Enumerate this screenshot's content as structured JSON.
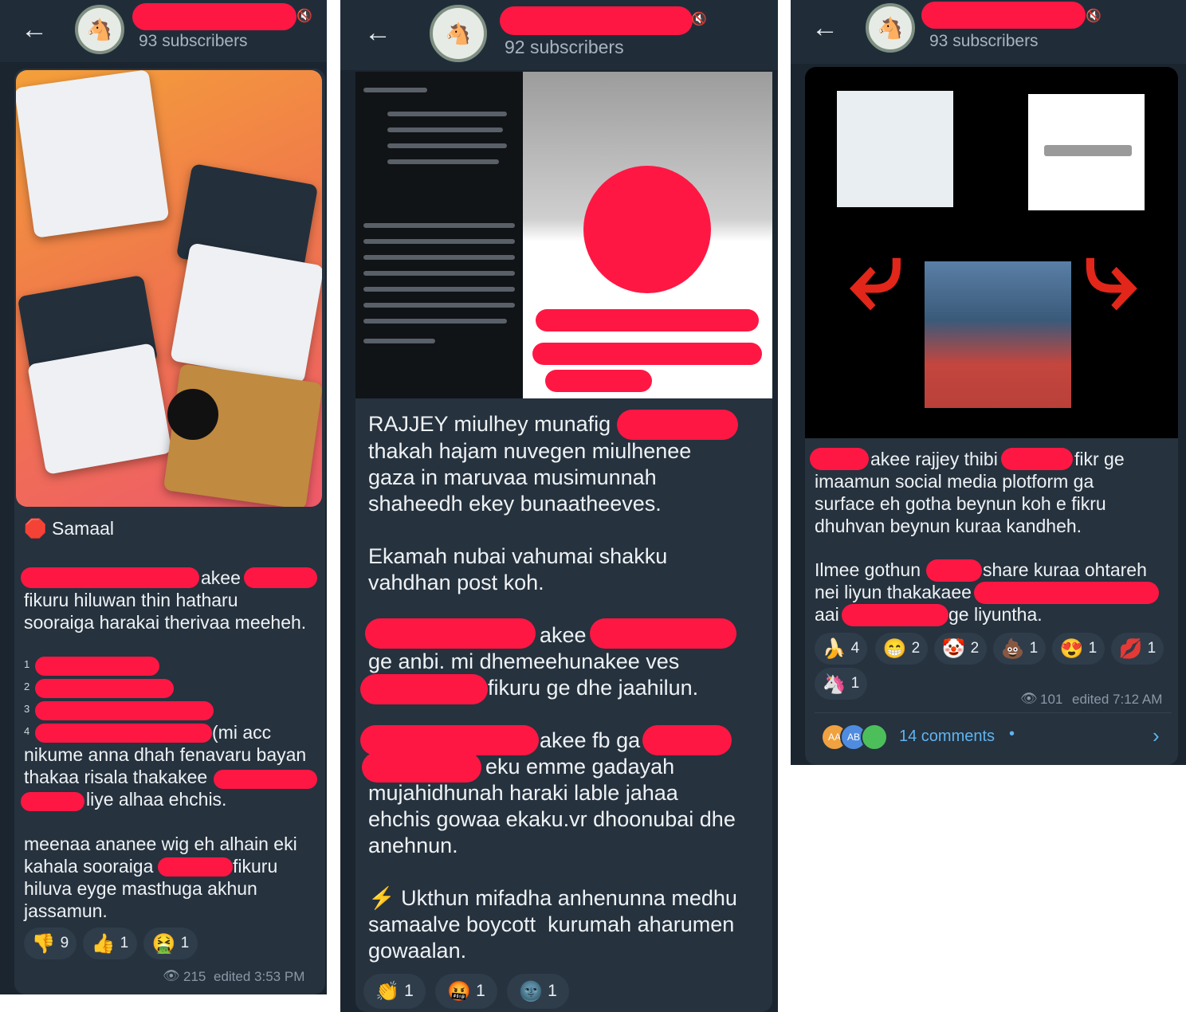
{
  "panels": [
    {
      "subscribers": "93 subscribers",
      "heading": "Samaal",
      "lines": [
        "akee",
        "fikuru hiluwan thin hatharu",
        "sooraiga harakai therivaa meeheh.",
        "(mi acc",
        "nikume anna dhah fenavaru bayan",
        "thakaa risala thakakee",
        "liye alhaa ehchis.",
        "meenaa ananee wig eh alhain eki",
        "kahala sooraiga",
        "fikuru",
        "hiluva eyge masthuga akhun",
        "jassamun."
      ],
      "list_numbers": [
        "1",
        "2",
        "3",
        "4"
      ],
      "reactions": [
        {
          "icon": "thumbs-down",
          "emoji": "👎",
          "count": "9"
        },
        {
          "icon": "thumbs-up",
          "emoji": "👍",
          "count": "1"
        },
        {
          "icon": "nauseated-face",
          "emoji": "🤮",
          "count": "1"
        }
      ],
      "views": "215",
      "edited": "edited 3:53 PM"
    },
    {
      "subscribers": "92 subscribers",
      "lines": [
        "RAJJEY miulhey munafig",
        "thakah hajam nuvegen miulhenee",
        "gaza in maruvaa musimunnah",
        "shaheedh ekey bunaatheeves.",
        "Ekamah nubai vahumai shakku",
        "vahdhan post koh.",
        "akee",
        "ge anbi. mi dhemeehunakee ves",
        "fikuru ge dhe jaahilun.",
        "akee fb ga",
        "eku emme gadayah",
        "mujahidhunah haraki lable jahaa",
        "ehchis gowaa ekaku.vr dhoonubai dhe",
        "anehnun.",
        "Ukthun mifadha anhenunna medhu",
        "samaalve boycott  kurumah aharumen",
        "gowaalan."
      ],
      "reactions": [
        {
          "icon": "clapping-hands",
          "emoji": "👏",
          "count": "1"
        },
        {
          "icon": "cursing-face",
          "emoji": "🤬",
          "count": "1"
        },
        {
          "icon": "new-moon-face",
          "emoji": "🌚",
          "count": "1"
        }
      ]
    },
    {
      "subscribers": "93 subscribers",
      "lines": [
        "akee rajjey thibi",
        "fikr ge",
        "imaamun social media plotform ga",
        "surface eh gotha beynun koh e fikru",
        "dhuhvan beynun kuraa kandheh.",
        "Ilmee gothun",
        "share kuraa ohtareh",
        "nei liyun thakakaee",
        "aai",
        "ge liyuntha."
      ],
      "reactions": [
        {
          "icon": "banana",
          "emoji": "🍌",
          "count": "4"
        },
        {
          "icon": "grinning-face",
          "emoji": "😁",
          "count": "2"
        },
        {
          "icon": "clown-face",
          "emoji": "🤡",
          "count": "2"
        },
        {
          "icon": "pile-of-poo",
          "emoji": "💩",
          "count": "1"
        },
        {
          "icon": "heart-eyes",
          "emoji": "😍",
          "count": "1"
        },
        {
          "icon": "kiss-mark",
          "emoji": "💋",
          "count": "1"
        },
        {
          "icon": "unicorn",
          "emoji": "🦄",
          "count": "1"
        }
      ],
      "views": "101",
      "edited": "edited 7:12 AM",
      "comments": "14 comments",
      "commenter_initials": [
        "AA",
        "AB",
        ""
      ]
    }
  ],
  "colors": {
    "bg": "#1b2530",
    "redaction": "#ff1744",
    "link": "#5fb4f0"
  }
}
